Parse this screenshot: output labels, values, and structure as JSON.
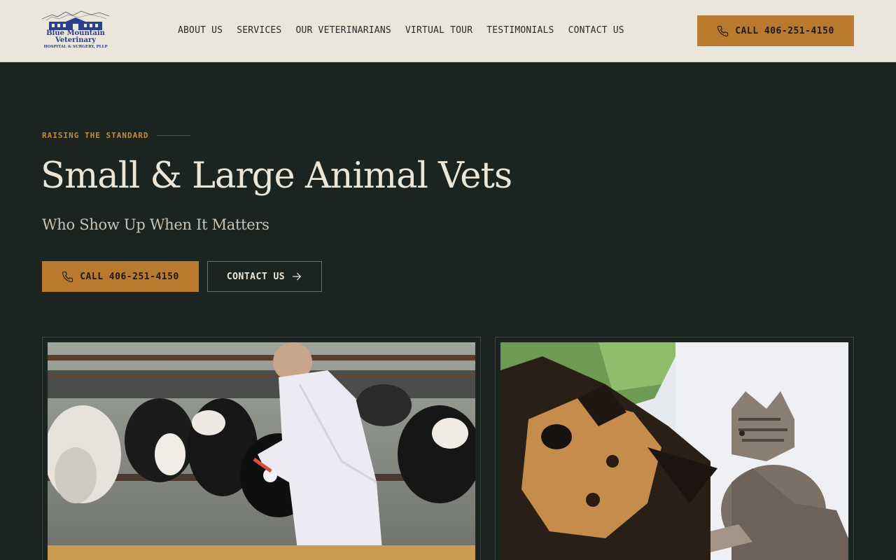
{
  "header": {
    "logo": {
      "line1": "Blue Mountain",
      "line2": "Veterinary",
      "line3": "HOSPITAL & SURGERY, PLLP"
    },
    "nav": [
      {
        "label": "ABOUT US"
      },
      {
        "label": "SERVICES"
      },
      {
        "label": "OUR VETERINARIANS"
      },
      {
        "label": "VIRTUAL TOUR"
      },
      {
        "label": "TESTIMONIALS"
      },
      {
        "label": "CONTACT US"
      }
    ],
    "call_button": {
      "label": "CALL 406-251-4150",
      "icon": "phone-icon"
    }
  },
  "hero": {
    "eyebrow": "RAISING THE STANDARD",
    "title": "Small & Large Animal Vets",
    "subtitle": "Who Show Up When It Matters",
    "call_button": {
      "label": "CALL 406-251-4150",
      "icon": "phone-icon"
    },
    "contact_button": {
      "label": "CONTACT US",
      "icon": "arrow-right-icon"
    }
  },
  "images": [
    {
      "name": "vet-with-cattle-photo"
    },
    {
      "name": "dog-and-kitten-photo"
    }
  ],
  "colors": {
    "header_bg": "#ebe6dc",
    "page_bg": "#1c2421",
    "accent": "#b97a2f",
    "eyebrow": "#c68a3c",
    "heading": "#ece6d8"
  }
}
